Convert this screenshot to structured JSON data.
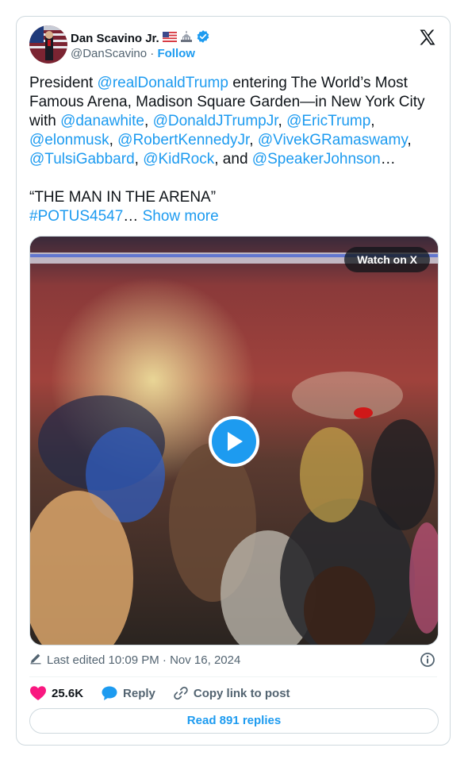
{
  "author": {
    "name": "Dan Scavino Jr.",
    "handle": "@DanScavino",
    "separator": "·",
    "follow_label": "Follow"
  },
  "tweet": {
    "t1": "President ",
    "m1": "@realDonaldTrump",
    "t2": " entering The World’s Most Famous Arena, Madison Square Garden—in New York City with ",
    "m2": "@danawhite",
    "t3": ", ",
    "m3": "@DonaldJTrumpJr",
    "t4": ", ",
    "m4": "@EricTrump",
    "t5": ", ",
    "m5": "@elonmusk",
    "t6": ", ",
    "m6": "@RobertKennedyJr",
    "t7": ", ",
    "m7": "@VivekGRamaswamy",
    "t8": ", ",
    "m8": "@TulsiGabbard",
    "t9": ", ",
    "m9": "@KidRock",
    "t10": ", and ",
    "m10": "@SpeakerJohnson",
    "t11": "…",
    "quote": "“THE MAN IN THE ARENA”",
    "hashtag": "#POTUS4547",
    "ellipsis": "… ",
    "show_more": "Show more"
  },
  "media": {
    "watch_label": "Watch on X"
  },
  "meta": {
    "edited": "Last edited 10:09 PM · Nov 16, 2024"
  },
  "actions": {
    "likes": "25.6K",
    "reply_label": "Reply",
    "copy_label": "Copy link to post",
    "read_replies": "Read 891 replies"
  },
  "colors": {
    "accent": "#1d9bf0",
    "like": "#f91880",
    "verified": "#1d9bf0"
  }
}
